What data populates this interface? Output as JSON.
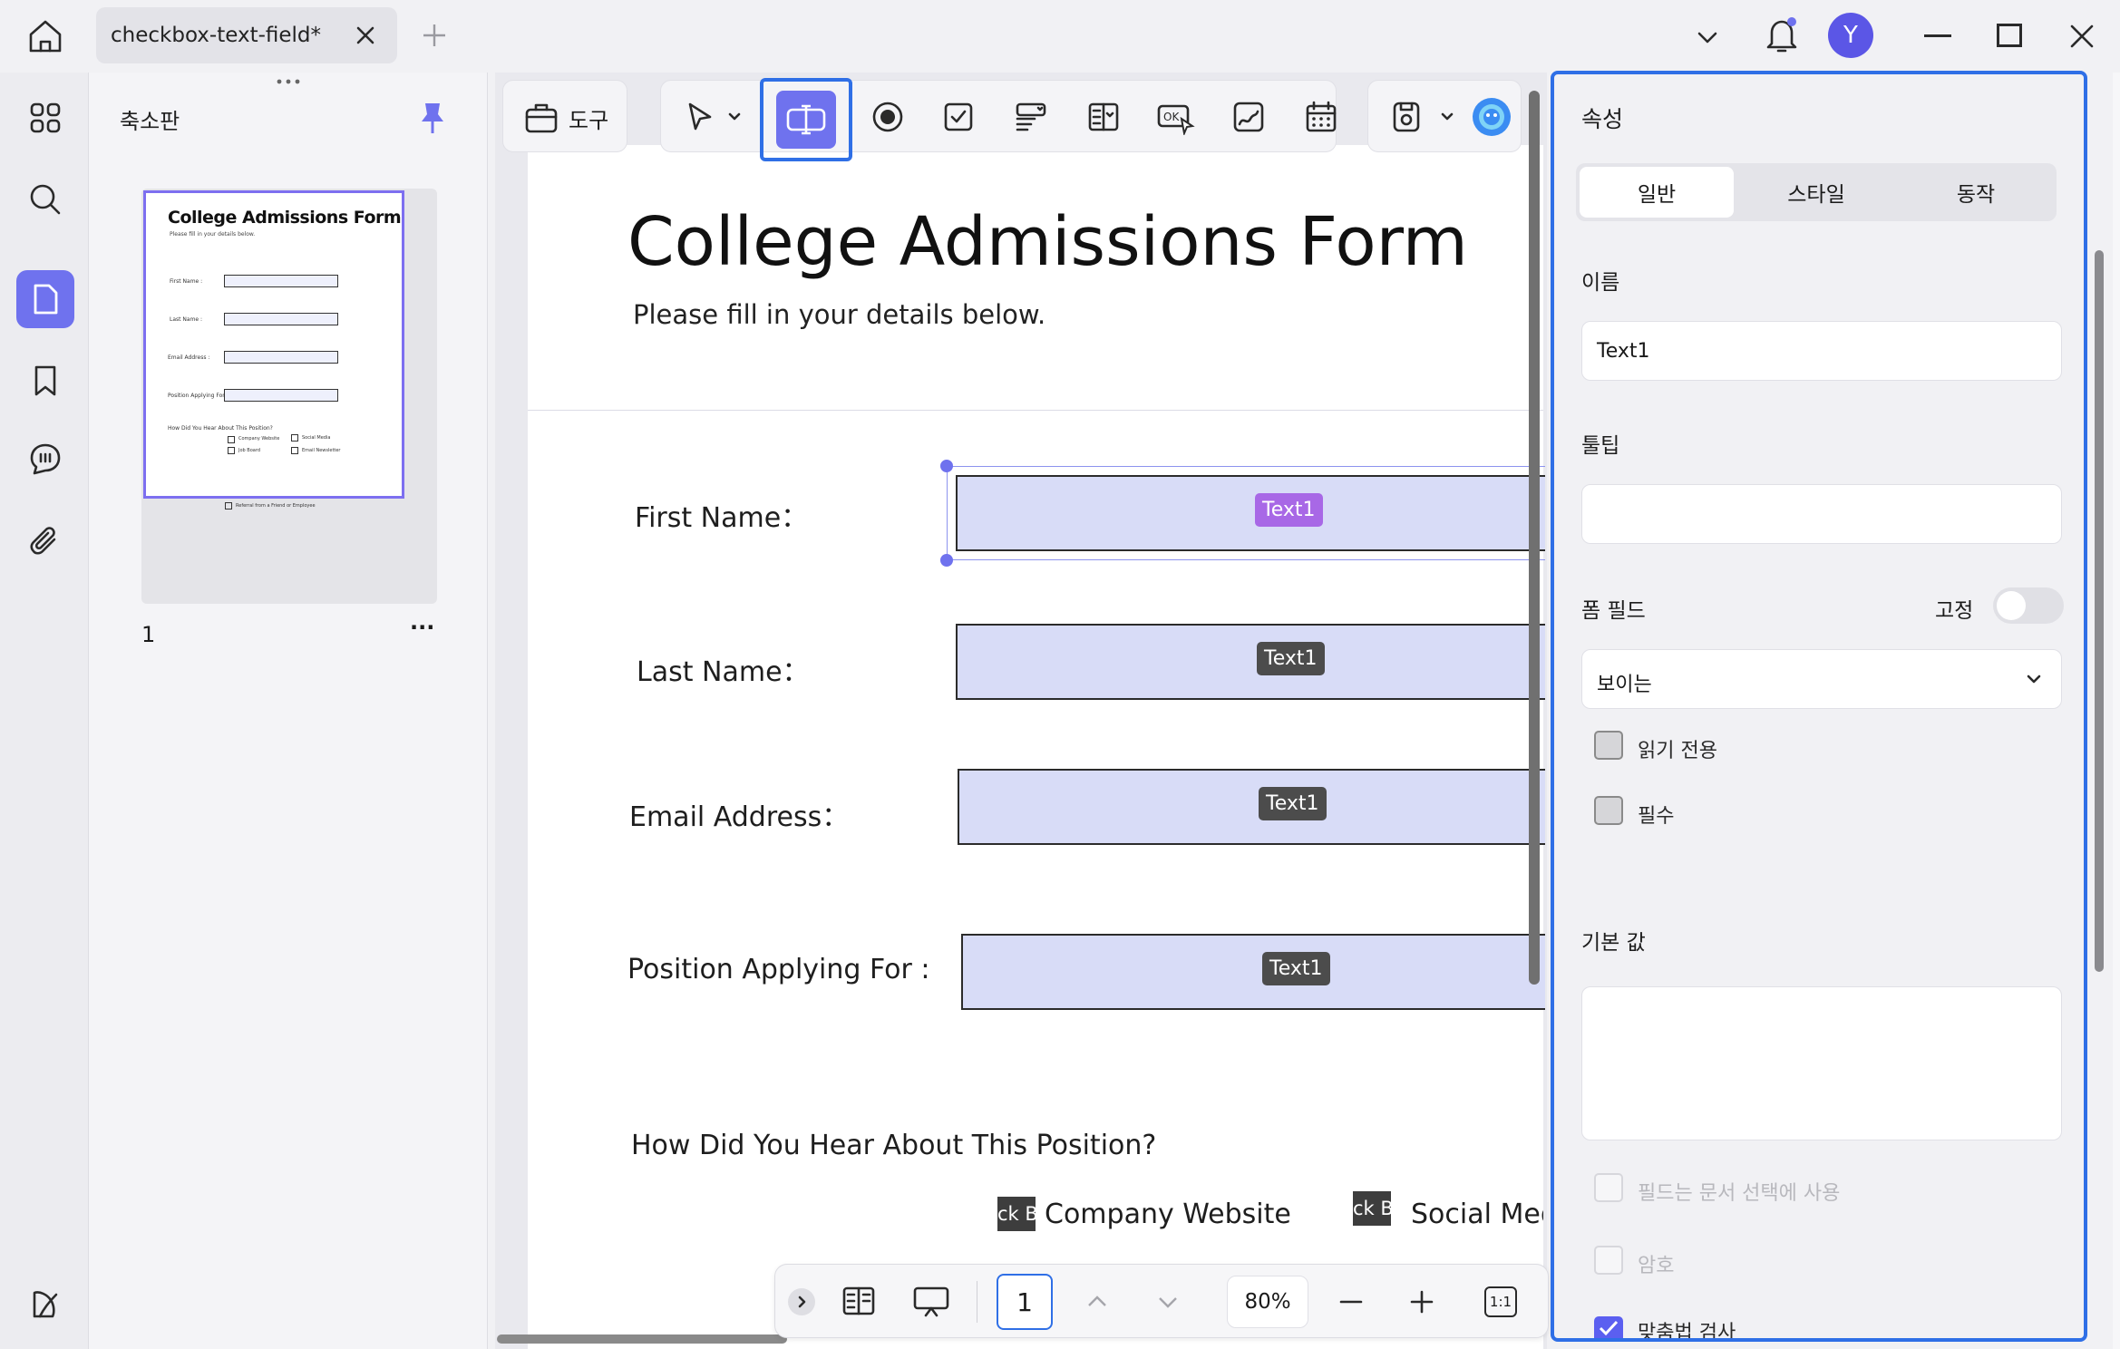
{
  "titlebar": {
    "tab_title": "checkbox-text-field*",
    "avatar_letter": "Y",
    "accent": "#6f72ee"
  },
  "thumbnails": {
    "title": "축소판",
    "page_number": "1",
    "more": "···",
    "thumb": {
      "title": "College Admissions Form",
      "subtitle": "Please fill in your details below.",
      "first_name": "First Name :",
      "last_name": "Last Name :",
      "email": "Email Address :",
      "position": "Position Applying For :",
      "question": "How Did You Hear About This Position?",
      "opt1": "Company Website",
      "opt2": "Social Media",
      "opt3": "Job Board",
      "opt4": "Email Newsletter",
      "opt5": "Referral from a Friend or Employee"
    }
  },
  "toolbar": {
    "tools_label": "도구"
  },
  "document": {
    "title": "College Admissions Form",
    "subtitle": "Please fill in your details below.",
    "fields": [
      {
        "label": "First Name：",
        "tag": "Text1"
      },
      {
        "label": "Last Name：",
        "tag": "Text1"
      },
      {
        "label": "Email Address：",
        "tag": "Text1"
      },
      {
        "label": "Position Applying For :",
        "tag": "Text1"
      }
    ],
    "question": "How Did You Hear About This Position?",
    "checkbox_tag": "ck B",
    "options": [
      "Company Website",
      "Social Medi"
    ]
  },
  "pagenav": {
    "current_page": "1",
    "zoom": "80%",
    "fit_label": "1:1"
  },
  "properties": {
    "header": "속성",
    "tabs": [
      "일반",
      "스타일",
      "동작"
    ],
    "active_tab": "일반",
    "name_label": "이름",
    "name_value": "Text1",
    "tooltip_label": "툴팁",
    "tooltip_value": "",
    "form_field_label": "폼 필드",
    "lock_label": "고정",
    "visibility_value": "보이는",
    "readonly_label": "읽기 전용",
    "required_label": "필수",
    "default_label": "기본 값",
    "doc_selection_label": "필드는 문서 선택에 사용",
    "password_label": "암호",
    "spellcheck_label": "맞춤법 검사"
  }
}
